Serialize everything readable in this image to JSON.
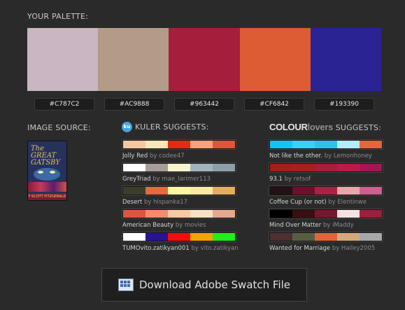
{
  "palette": {
    "heading": "YOUR PALETTE:",
    "swatches": [
      {
        "hex": "#C787C2",
        "color": "#cab6c3"
      },
      {
        "hex": "#AC9888",
        "color": "#b49a88"
      },
      {
        "hex": "#963442",
        "color": "#a51f3c"
      },
      {
        "hex": "#CF6842",
        "color": "#dd5c34"
      },
      {
        "hex": "#193390",
        "color": "#2a2394"
      }
    ]
  },
  "image_source": {
    "heading": "IMAGE SOURCE:",
    "book_title": "The GREAT GATSBY",
    "book_author": "F·SCOTT FITZGERALD"
  },
  "kuler": {
    "logo_text": "ku",
    "heading": "KULER SUGGESTS:",
    "suggestions": [
      {
        "name": "Jolly Red",
        "by": "by codee47",
        "colors": [
          "#f5c8a0",
          "#f6e7b8",
          "#dd2e14",
          "#f6a27a",
          "#d9583a"
        ]
      },
      {
        "name": "GreyTriad",
        "by": "by mae_larimer113",
        "colors": [
          "#ffffff",
          "#a89c9a",
          "#f8f4cc",
          "#a3b3bd",
          "#8e9fa7"
        ]
      },
      {
        "name": "Desert",
        "by": "by hispanka17",
        "colors": [
          "#3d3d2c",
          "#e86a3b",
          "#f9f7a0",
          "#fae9a2",
          "#e3ad5d"
        ]
      },
      {
        "name": "American Beauty",
        "by": "by movies",
        "colors": [
          "#d9573e",
          "#f28c6a",
          "#fbc8a3",
          "#fce0c2",
          "#e4a98d"
        ]
      },
      {
        "name": "TUMOvito.zatikyan001",
        "by": "by vito.zatikyan",
        "colors": [
          "#ffffff",
          "#2a1290",
          "#f30e0e",
          "#f3a20b",
          "#23ed1a"
        ]
      }
    ]
  },
  "colourlovers": {
    "logo_bold": "COLOUR",
    "logo_light": "lovers",
    "heading": "SUGGESTS:",
    "suggestions": [
      {
        "name": "Not like the other.",
        "by": "by Lemonhoney",
        "colors": [
          "#17c4f0",
          "#3ad1f5",
          "#32bfe8",
          "#b3ecfa",
          "#e3673a"
        ]
      },
      {
        "name": "93.1",
        "by": "by retsof",
        "colors": [
          "#a31f1a",
          "#a6201e",
          "#a51f3a",
          "#b81a4a",
          "#a81556"
        ]
      },
      {
        "name": "Coffee Cup (or not)",
        "by": "by Elentinwe",
        "colors": [
          "#231214",
          "#6e0f2c",
          "#b01e44",
          "#e8a6a8",
          "#cf5f8e"
        ]
      },
      {
        "name": "Mind Over Matter",
        "by": "by iMaddy",
        "colors": [
          "#000000",
          "#3a0f12",
          "#7a1530",
          "#f5e0e3",
          "#9e1e3c"
        ]
      },
      {
        "name": "Wanted for Marriage",
        "by": "by Hailey2005",
        "colors": [
          "#4f2f30",
          "#566040",
          "#e0653a",
          "#d7a97a",
          "#a8a8a8"
        ]
      }
    ]
  },
  "download": {
    "label": "Download Adobe Swatch File",
    "icon": "swatch-file-icon"
  }
}
